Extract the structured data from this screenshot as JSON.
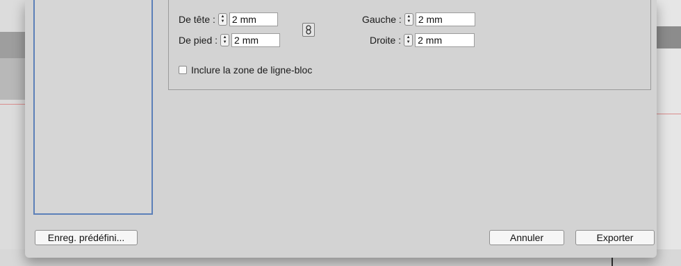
{
  "margins": {
    "top": {
      "label": "De tête :",
      "value": "2 mm"
    },
    "bottom": {
      "label": "De pied :",
      "value": "2 mm"
    },
    "left": {
      "label": "Gauche :",
      "value": "2 mm"
    },
    "right": {
      "label": "Droite :",
      "value": "2 mm"
    },
    "link_icon": "chain-link-icon"
  },
  "options": {
    "include_block_line_zone": {
      "label": "Inclure la zone de ligne-bloc",
      "checked": false
    }
  },
  "buttons": {
    "save_preset": "Enreg. prédéfini...",
    "cancel": "Annuler",
    "export": "Exporter"
  },
  "colors": {
    "dialog_bg": "#d3d3d3",
    "list_border": "#5b7fb8"
  }
}
